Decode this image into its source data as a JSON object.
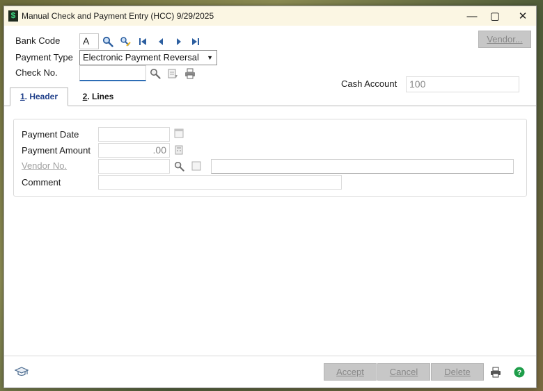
{
  "window": {
    "title": "Manual Check and Payment Entry (HCC) 9/29/2025",
    "app_icon_glyph": "$",
    "minimize_glyph": "—",
    "maximize_glyph": "▢",
    "close_glyph": "✕"
  },
  "form": {
    "bank_code_label": "Bank Code",
    "bank_code_value": "A",
    "payment_type_label": "Payment Type",
    "payment_type_value": "Electronic Payment Reversal",
    "check_no_label": "Check No.",
    "check_no_value": "",
    "cash_account_label": "Cash Account",
    "cash_account_value": "100",
    "vendor_button": "Vendor..."
  },
  "tabs": [
    {
      "key": "1",
      "label": ". Header"
    },
    {
      "key": "2",
      "label": ". Lines"
    }
  ],
  "header_panel": {
    "payment_date_label": "Payment Date",
    "payment_date_value": "",
    "payment_amount_label": "Payment Amount",
    "payment_amount_value": ".00",
    "vendor_no_label": "Vendor No.",
    "vendor_no_value": "",
    "vendor_name_value": "",
    "comment_label": "Comment",
    "comment_value": ""
  },
  "footer": {
    "accept": "Accept",
    "cancel": "Cancel",
    "delete": "Delete"
  },
  "icons": {
    "lookup": "magnifier-icon",
    "first": "first-record-icon",
    "prev": "previous-record-icon",
    "next": "next-record-icon",
    "last": "last-record-icon",
    "print": "printer-icon",
    "help": "help-icon",
    "calendar": "calendar-icon",
    "calculator": "calculator-icon"
  },
  "colors": {
    "accent_blue": "#2d6db5",
    "tab_active_text": "#1f3f8a",
    "help_green": "#1e9e4a",
    "titlebar_bg": "#fbf6e3"
  }
}
